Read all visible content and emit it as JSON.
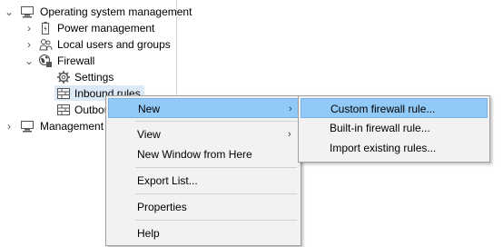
{
  "tree": {
    "root_label": "Operating system management",
    "items": [
      {
        "label": "Power management"
      },
      {
        "label": "Local users and groups"
      },
      {
        "label": "Firewall"
      },
      {
        "label": "Settings"
      },
      {
        "label": "Inbound rules"
      },
      {
        "label": "Outbound rules"
      },
      {
        "label": "Management"
      }
    ]
  },
  "context_menu": {
    "items": [
      {
        "label": "New"
      },
      {
        "label": "View"
      },
      {
        "label": "New Window from Here"
      },
      {
        "label": "Export List..."
      },
      {
        "label": "Properties"
      },
      {
        "label": "Help"
      }
    ]
  },
  "submenu": {
    "items": [
      {
        "label": "Custom firewall rule..."
      },
      {
        "label": "Built-in firewall rule..."
      },
      {
        "label": "Import existing rules..."
      }
    ]
  },
  "colors": {
    "highlight": "#91c9f7",
    "selection": "#dceaf8",
    "menu_bg": "#f2f2f2"
  },
  "icons": {
    "chevron_collapsed": "chevron-right-icon",
    "chevron_expanded": "chevron-down-icon",
    "submenu_arrow": "chevron-right-icon"
  }
}
